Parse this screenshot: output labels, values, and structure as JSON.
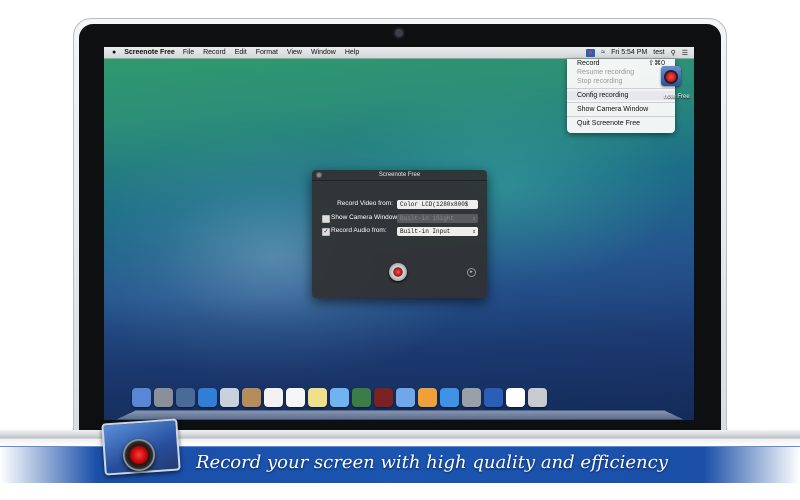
{
  "menubar": {
    "apple": "",
    "app_name": "Screenote Free",
    "items": [
      "File",
      "Record",
      "Edit",
      "Format",
      "View",
      "Window",
      "Help"
    ],
    "clock": "Fri 5:54 PM",
    "user": "test"
  },
  "dropdown": {
    "record": "Record",
    "record_shortcut": "⇧⌘0",
    "resume": "Resume recording",
    "stop": "Stop recording",
    "config": "Config recording",
    "show_camera": "Show Camera Window",
    "quit": "Quit Screenote Free"
  },
  "desktop_icon_label": "note Free",
  "window": {
    "title": "Screenote Free",
    "record_video_label": "Record Video from:",
    "record_video_value": "Color LCD(1280x800$",
    "show_camera_label": "Show Camera Window:",
    "show_camera_value": "Built-in iSight",
    "show_camera_checked": false,
    "record_audio_label": "Record Audio from:",
    "record_audio_value": "Built-in Input",
    "record_audio_checked": true
  },
  "dock": {
    "icons": [
      "finder-icon",
      "launchpad-icon",
      "mission-control-icon",
      "safari-icon",
      "mail-icon",
      "contacts-icon",
      "calendar-icon",
      "reminders-icon",
      "notes-icon",
      "messages-icon",
      "facetime-icon",
      "photo-booth-icon",
      "itunes-icon",
      "books-icon",
      "app-store-icon",
      "preferences-icon",
      "screenote-icon",
      "documents-icon",
      "trash-icon"
    ],
    "colors": [
      "#5a86d6",
      "#8a8f99",
      "#4a6b9a",
      "#2f7fd6",
      "#c9d2dc",
      "#b58c5a",
      "#f2f2f2",
      "#f6f6f6",
      "#efe08a",
      "#6fb4f0",
      "#3c7c46",
      "#7a2222",
      "#6fa7e8",
      "#f0a03a",
      "#3f93e6",
      "#9aa0a8",
      "#2a5fb7",
      "#ffffff",
      "#c8cbd0"
    ]
  },
  "banner": {
    "text": "Record your screen with high quality and efficiency"
  }
}
